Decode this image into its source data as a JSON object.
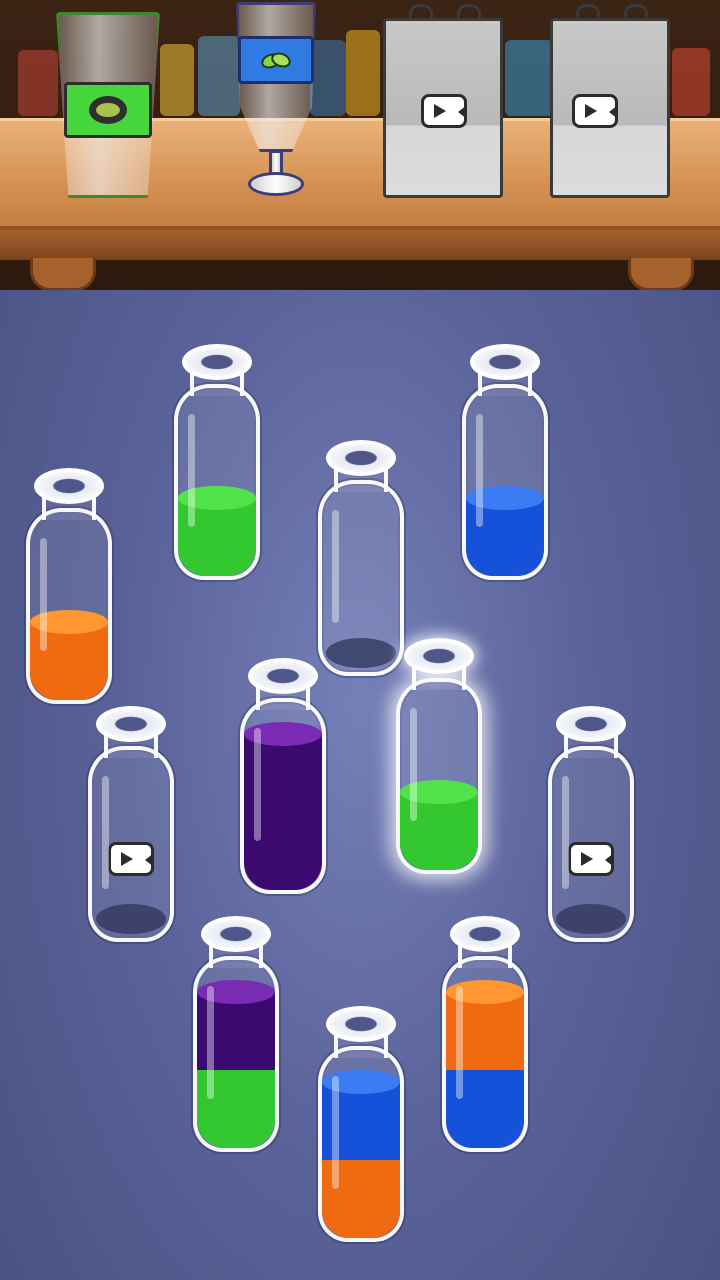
{
  "colors": {
    "green": "#33c830",
    "green_top": "#52e34b",
    "blue": "#1552d9",
    "blue_top": "#3b7cf4",
    "orange": "#f06a12",
    "orange_top": "#ff9630",
    "purple": "#3a0a6e",
    "purple_top": "#7a2bb4"
  },
  "shelf": {
    "orders": [
      {
        "kind": "cup",
        "band_color": "#44d63b",
        "icon": "avocado-icon"
      },
      {
        "kind": "glass",
        "band_color": "#2f7be3",
        "icon": "leaf-icon"
      },
      {
        "kind": "bag",
        "locked": true,
        "icon": "video-icon"
      },
      {
        "kind": "bag",
        "locked": true,
        "icon": "video-icon"
      }
    ]
  },
  "bottles": [
    {
      "id": "b1",
      "layers": [
        "orange"
      ],
      "selected": false,
      "locked": false
    },
    {
      "id": "b2",
      "layers": [
        "green"
      ],
      "selected": false,
      "locked": false
    },
    {
      "id": "b3",
      "layers": [],
      "selected": false,
      "locked": false
    },
    {
      "id": "b4",
      "layers": [
        "blue"
      ],
      "selected": false,
      "locked": false
    },
    {
      "id": "b5",
      "layers": [],
      "selected": false,
      "locked": true
    },
    {
      "id": "b6",
      "layers": [
        "purple",
        "purple"
      ],
      "selected": false,
      "locked": false
    },
    {
      "id": "b7",
      "layers": [
        "green"
      ],
      "selected": true,
      "locked": false
    },
    {
      "id": "b8",
      "layers": [],
      "selected": false,
      "locked": true
    },
    {
      "id": "b9",
      "layers": [
        "green",
        "purple"
      ],
      "selected": false,
      "locked": false
    },
    {
      "id": "b10",
      "layers": [
        "orange",
        "blue"
      ],
      "selected": false,
      "locked": false
    },
    {
      "id": "b11",
      "layers": [
        "blue",
        "orange"
      ],
      "selected": false,
      "locked": false
    }
  ]
}
